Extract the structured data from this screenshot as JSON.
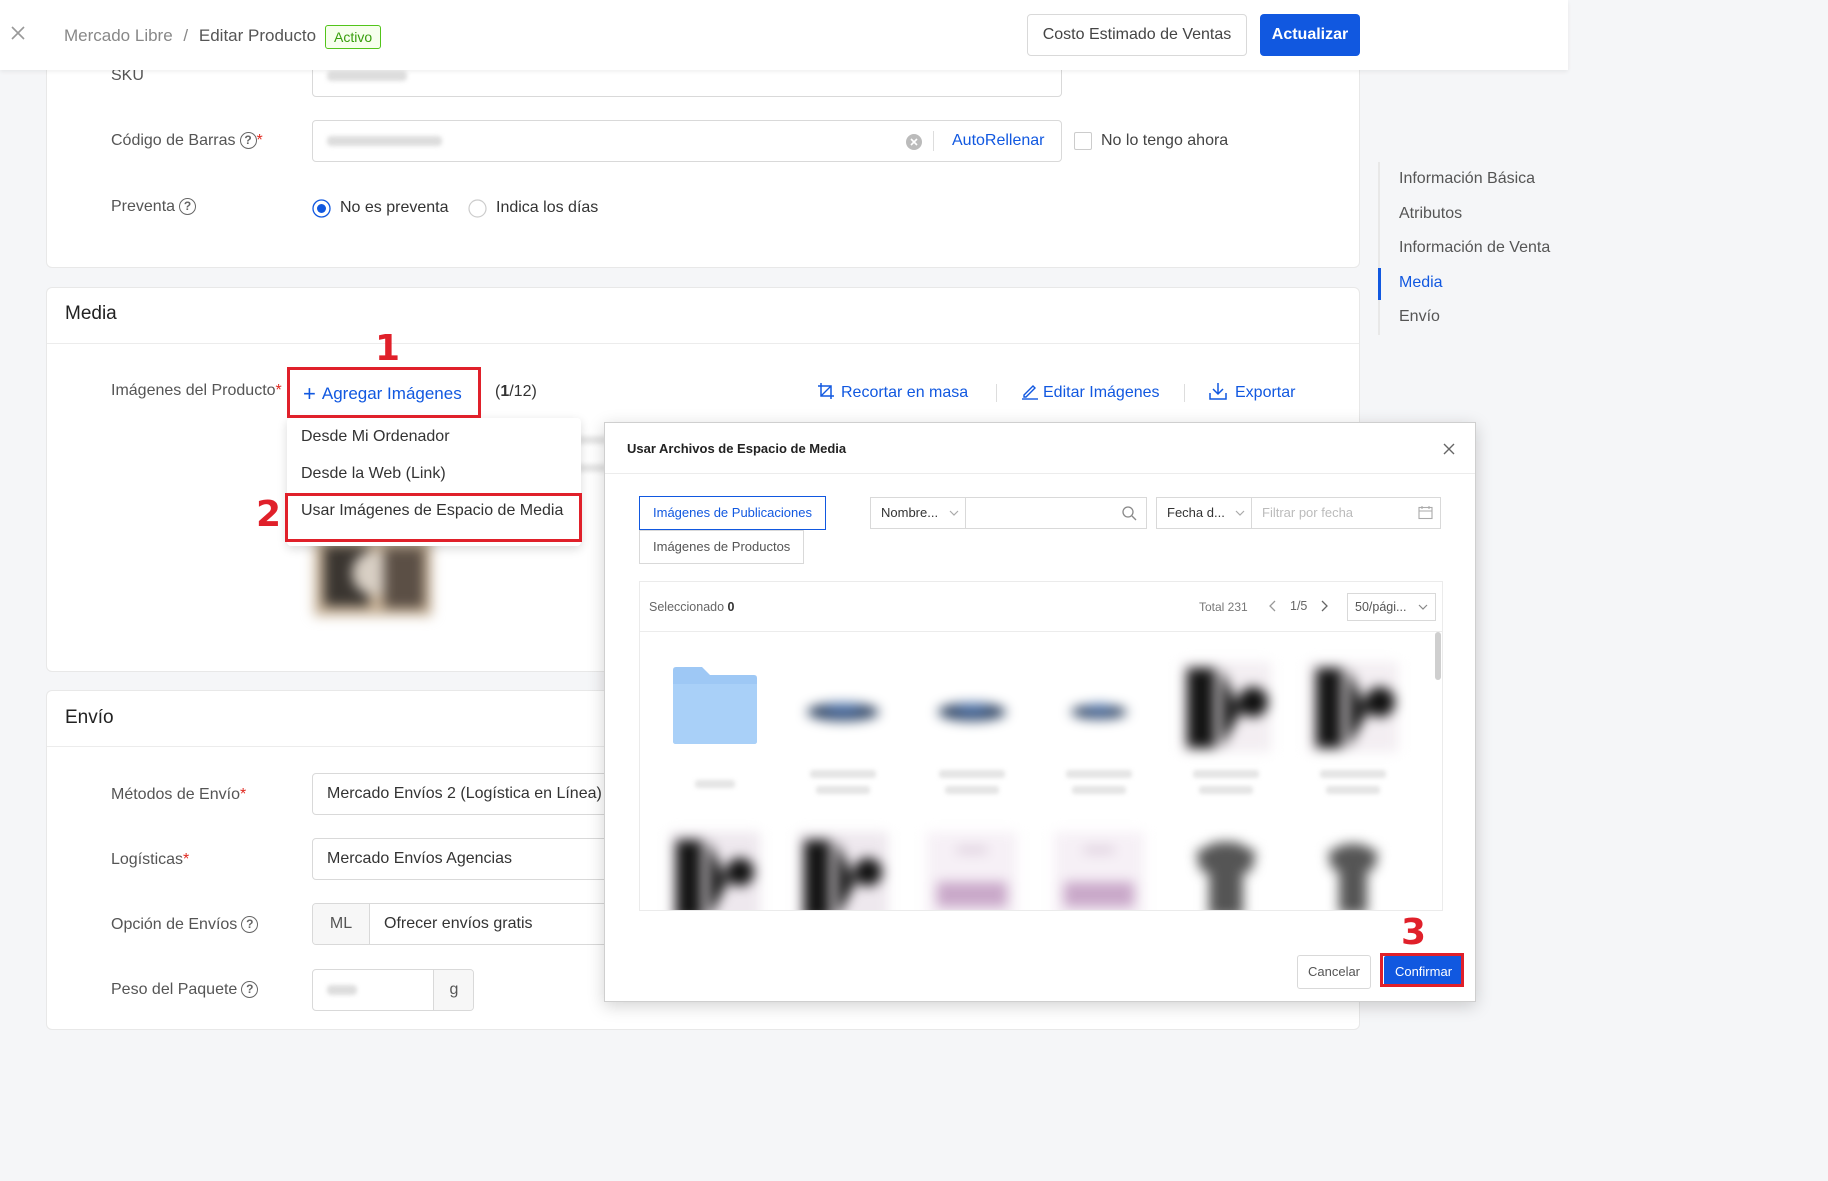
{
  "header": {
    "breadcrumb_root": "Mercado Libre",
    "breadcrumb_sep": "/",
    "breadcrumb_current": "Editar Producto",
    "status_badge": "Activo",
    "costo_button": "Costo Estimado de Ventas",
    "actualizar_button": "Actualizar"
  },
  "basic": {
    "sku_label": "SKU",
    "barcode_label": "Código de Barras",
    "barcode_required": "*",
    "autofill": "AutoRellenar",
    "no_barcode": "No lo tengo ahora",
    "preventa_label": "Preventa",
    "preventa_opt1": "No es preventa",
    "preventa_opt2": "Indica los días"
  },
  "media": {
    "title": "Media",
    "images_label": "Imágenes del Producto",
    "required": "*",
    "add_images": "Agregar Imágenes",
    "count_current": "1",
    "count_suffix": "/12)",
    "count_prefix": "(",
    "crop": "Recortar en masa",
    "edit": "Editar Imágenes",
    "export": "Exportar",
    "menu": {
      "opt1": "Desde Mi Ordenador",
      "opt2": "Desde la Web (Link)",
      "opt3": "Usar Imágenes de Espacio de Media"
    }
  },
  "envio": {
    "title": "Envío",
    "metodos_label": "Métodos de Envío",
    "metodos_value": "Mercado Envíos 2 (Logística en Línea)",
    "logisticas_label": "Logísticas",
    "logisticas_value": "Mercado Envíos Agencias",
    "opcion_label": "Opción de Envíos",
    "opcion_prefix": "ML",
    "opcion_value": "Ofrecer envíos gratis",
    "peso_label": "Peso del Paquete",
    "peso_unit": "g",
    "required": "*"
  },
  "sidenav": {
    "items": [
      "Información Básica",
      "Atributos",
      "Información de Venta",
      "Media",
      "Envío"
    ],
    "active": "Media"
  },
  "modal": {
    "title": "Usar Archivos de Espacio de Media",
    "tab1": "Imágenes de Publicaciones",
    "tab2": "Imágenes de Productos",
    "name_select": "Nombre...",
    "date_select": "Fecha d...",
    "date_placeholder": "Filtrar por fecha",
    "selected_label": "Seleccionado",
    "selected_count": "0",
    "total": "Total 231",
    "page": "1/5",
    "per_page": "50/pági...",
    "cancel": "Cancelar",
    "confirm": "Confirmar"
  },
  "annotations": {
    "step1": "1",
    "step2": "2",
    "step3": "3"
  },
  "colors": {
    "primary": "#1158e0",
    "annotation_red": "#e0202a",
    "active_green": "#52c41a"
  }
}
